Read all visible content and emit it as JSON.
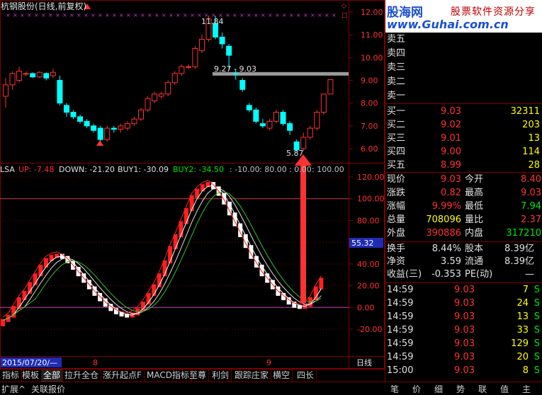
{
  "title": "杭钢股份(日线,前复权)",
  "colors": {
    "up": "#ff3232",
    "down": "#00ffff",
    "bg": "#000000",
    "frame": "#800000",
    "yellow": "#ffff00"
  },
  "main_chart": {
    "annotations": {
      "high": "11.84",
      "range": "9.27 - 9.03",
      "low": "5.87"
    },
    "price_axis": [
      "12.00",
      "11.00",
      "10.00",
      "9.00",
      "8.00",
      "7.00",
      "6.00"
    ]
  },
  "indicator": {
    "name": "LSA",
    "up_label": "UP: -7.48",
    "down_label": "DOWN: -21.20",
    "buy1_label": "BUY1: -30.09",
    "buy2_label": "BUY2: -34.50",
    "l1": ": -10.00",
    "l2": ": 80.00",
    "l3": ": 0.00",
    "l4": ": 100.00",
    "axis": [
      "120.00",
      "100.00",
      "80.00",
      "60.00",
      "40.00",
      "20.00",
      "0.00",
      "-20.00"
    ],
    "cursor_value": "55.32"
  },
  "date_axis": {
    "start": "2015/07/20/—",
    "m8": "8",
    "m9": "9",
    "period": "日线"
  },
  "chart_data": {
    "type": "candlestick",
    "y_axis_ticks": [
      6.0,
      7.0,
      8.0,
      9.0,
      10.0,
      11.0,
      12.0
    ],
    "candles": [
      {
        "o": 8.3,
        "c": 8.8,
        "h": 9.1,
        "l": 7.8
      },
      {
        "o": 8.8,
        "c": 9.3,
        "h": 9.4,
        "l": 8.6
      },
      {
        "o": 9.0,
        "c": 9.4,
        "h": 9.6,
        "l": 8.9
      },
      {
        "o": 9.3,
        "c": 9.3,
        "h": 9.4,
        "l": 9.2
      },
      {
        "o": 9.3,
        "c": 9.15,
        "h": 9.35,
        "l": 9.1
      },
      {
        "o": 9.15,
        "c": 9.35,
        "h": 9.4,
        "l": 9.1
      },
      {
        "o": 9.3,
        "c": 9.1,
        "h": 9.35,
        "l": 9.0
      },
      {
        "o": 9.2,
        "c": 9.35,
        "h": 9.5,
        "l": 9.1
      },
      {
        "o": 9.0,
        "c": 8.0,
        "h": 9.2,
        "l": 7.9
      },
      {
        "o": 7.9,
        "c": 7.6,
        "h": 8.0,
        "l": 7.4
      },
      {
        "o": 7.6,
        "c": 7.4,
        "h": 7.7,
        "l": 7.3
      },
      {
        "o": 7.4,
        "c": 7.2,
        "h": 7.5,
        "l": 7.1
      },
      {
        "o": 7.2,
        "c": 7.0,
        "h": 7.3,
        "l": 6.9
      },
      {
        "o": 7.0,
        "c": 6.8,
        "h": 7.1,
        "l": 6.7
      },
      {
        "o": 6.9,
        "c": 6.4,
        "h": 7.0,
        "l": 6.3
      },
      {
        "o": 6.4,
        "c": 6.9,
        "h": 7.0,
        "l": 6.3
      },
      {
        "o": 6.9,
        "c": 6.85,
        "h": 7.0,
        "l": 6.7
      },
      {
        "o": 6.85,
        "c": 7.0,
        "h": 7.1,
        "l": 6.7
      },
      {
        "o": 6.9,
        "c": 7.1,
        "h": 7.2,
        "l": 6.8
      },
      {
        "o": 7.1,
        "c": 7.3,
        "h": 7.4,
        "l": 7.0
      },
      {
        "o": 7.3,
        "c": 7.7,
        "h": 7.8,
        "l": 7.2
      },
      {
        "o": 7.7,
        "c": 8.2,
        "h": 8.3,
        "l": 7.6
      },
      {
        "o": 8.1,
        "c": 8.4,
        "h": 8.5,
        "l": 8.0
      },
      {
        "o": 8.3,
        "c": 8.4,
        "h": 8.5,
        "l": 8.2
      },
      {
        "o": 8.4,
        "c": 8.9,
        "h": 9.0,
        "l": 8.3
      },
      {
        "o": 8.9,
        "c": 9.3,
        "h": 9.4,
        "l": 8.8
      },
      {
        "o": 9.3,
        "c": 9.6,
        "h": 9.7,
        "l": 9.2
      },
      {
        "o": 9.6,
        "c": 9.6,
        "h": 9.7,
        "l": 9.5
      },
      {
        "o": 9.6,
        "c": 10.4,
        "h": 10.5,
        "l": 9.5
      },
      {
        "o": 10.3,
        "c": 10.8,
        "h": 11.0,
        "l": 10.2
      },
      {
        "o": 10.8,
        "c": 11.7,
        "h": 11.84,
        "l": 10.7
      },
      {
        "o": 11.5,
        "c": 10.9,
        "h": 11.84,
        "l": 10.8
      },
      {
        "o": 10.9,
        "c": 10.6,
        "h": 11.1,
        "l": 10.4
      },
      {
        "o": 10.5,
        "c": 10.1,
        "h": 10.6,
        "l": 9.5
      },
      {
        "o": 9.3,
        "c": 9.27,
        "h": 9.5,
        "l": 9.03
      },
      {
        "o": 9.0,
        "c": 8.6,
        "h": 9.1,
        "l": 8.5
      },
      {
        "o": 7.9,
        "c": 7.7,
        "h": 8.0,
        "l": 7.6
      },
      {
        "o": 7.7,
        "c": 7.2,
        "h": 7.8,
        "l": 7.1
      },
      {
        "o": 7.1,
        "c": 7.0,
        "h": 7.3,
        "l": 6.9
      },
      {
        "o": 6.9,
        "c": 7.2,
        "h": 7.3,
        "l": 6.8
      },
      {
        "o": 7.2,
        "c": 7.6,
        "h": 7.7,
        "l": 7.1
      },
      {
        "o": 7.6,
        "c": 7.1,
        "h": 7.7,
        "l": 7.0
      },
      {
        "o": 7.1,
        "c": 6.8,
        "h": 7.2,
        "l": 6.6
      },
      {
        "o": 6.3,
        "c": 5.95,
        "h": 6.4,
        "l": 5.87
      },
      {
        "o": 6.0,
        "c": 6.5,
        "h": 6.7,
        "l": 5.9
      },
      {
        "o": 6.5,
        "c": 6.9,
        "h": 7.0,
        "l": 6.4
      },
      {
        "o": 6.9,
        "c": 7.6,
        "h": 7.7,
        "l": 6.8
      },
      {
        "o": 7.6,
        "c": 8.4,
        "h": 8.4,
        "l": 7.5
      },
      {
        "o": 8.4,
        "c": 9.03,
        "h": 9.03,
        "l": 8.4
      }
    ],
    "indicator_ticks": [
      -20,
      0,
      20,
      40,
      60,
      80,
      100,
      120
    ],
    "indicator_bars": [
      -12,
      -8,
      0,
      8,
      14,
      22,
      30,
      38,
      44,
      47,
      48,
      46,
      42,
      36,
      30,
      24,
      18,
      12,
      7,
      2,
      -2,
      -5,
      -7,
      -8,
      -6,
      -2,
      4,
      12,
      20,
      30,
      42,
      55,
      66,
      78,
      90,
      102,
      108,
      112,
      114,
      110,
      104,
      96,
      86,
      76,
      66,
      56,
      46,
      38,
      30,
      24,
      18,
      12,
      8,
      4,
      1,
      0,
      2,
      8,
      18,
      26
    ]
  },
  "quotes": {
    "asks": [
      {
        "label": "卖五",
        "price": "",
        "vol": ""
      },
      {
        "label": "卖四",
        "price": "",
        "vol": ""
      },
      {
        "label": "卖三",
        "price": "",
        "vol": ""
      },
      {
        "label": "卖二",
        "price": "",
        "vol": ""
      },
      {
        "label": "卖一",
        "price": "",
        "vol": ""
      }
    ],
    "bids": [
      {
        "label": "买一",
        "price": "9.03",
        "vol": "32311"
      },
      {
        "label": "买二",
        "price": "9.02",
        "vol": "203"
      },
      {
        "label": "买三",
        "price": "9.01",
        "vol": "13"
      },
      {
        "label": "买四",
        "price": "9.00",
        "vol": "114"
      },
      {
        "label": "买五",
        "price": "8.99",
        "vol": "28"
      }
    ],
    "stats": [
      {
        "l1": "现价",
        "v1": "9.03",
        "l2": "今开",
        "v2": "8.40",
        "c1": "red",
        "c2": "red"
      },
      {
        "l1": "涨跌",
        "v1": "0.82",
        "l2": "最高",
        "v2": "9.03",
        "c1": "red",
        "c2": "red"
      },
      {
        "l1": "涨幅",
        "v1": "9.99%",
        "l2": "最低",
        "v2": "7.94",
        "c1": "red",
        "c2": "green"
      },
      {
        "l1": "总量",
        "v1": "708096",
        "l2": "量比",
        "v2": "2.37",
        "c1": "yellow",
        "c2": "red"
      },
      {
        "l1": "外盘",
        "v1": "390886",
        "l2": "内盘",
        "v2": "317210",
        "c1": "red",
        "c2": "green"
      }
    ],
    "info": [
      {
        "l1": "换手",
        "v1": "8.44%",
        "l2": "股本",
        "v2": "8.39亿"
      },
      {
        "l1": "净资",
        "v1": "3.59",
        "l2": "流通",
        "v2": "8.39亿"
      },
      {
        "l1": "收益(三)",
        "v1": "-0.353",
        "l2": "PE(动)",
        "v2": "—"
      }
    ],
    "ticks": [
      {
        "t": "14:59",
        "p": "9.03",
        "v": "7",
        "s": "S"
      },
      {
        "t": "14:59",
        "p": "9.03",
        "v": "24",
        "s": "S"
      },
      {
        "t": "14:59",
        "p": "9.03",
        "v": "13",
        "s": "S"
      },
      {
        "t": "14:59",
        "p": "9.03",
        "v": "33",
        "s": "S"
      },
      {
        "t": "14:59",
        "p": "9.03",
        "v": "129",
        "s": "S"
      },
      {
        "t": "14:59",
        "p": "9.03",
        "v": "20",
        "s": "S"
      },
      {
        "t": "15:00",
        "p": "9.03",
        "v": "8",
        "s": "S"
      }
    ]
  },
  "logo": {
    "main": "股海网",
    "sub": "股票软件资源分享",
    "url": "www.Guhai.com.cn"
  },
  "tabs": [
    "指标",
    "模板",
    "全部",
    "拉升全仓",
    "涨升起点F",
    "MACD指标",
    "至尊",
    "利剑",
    "跟踪庄家",
    "横空",
    "四长"
  ],
  "bottom": {
    "expand": "扩展^",
    "related": "关联报价"
  },
  "right_tabs": [
    "笔",
    "价",
    "细",
    "势",
    "联",
    "值",
    "主"
  ]
}
